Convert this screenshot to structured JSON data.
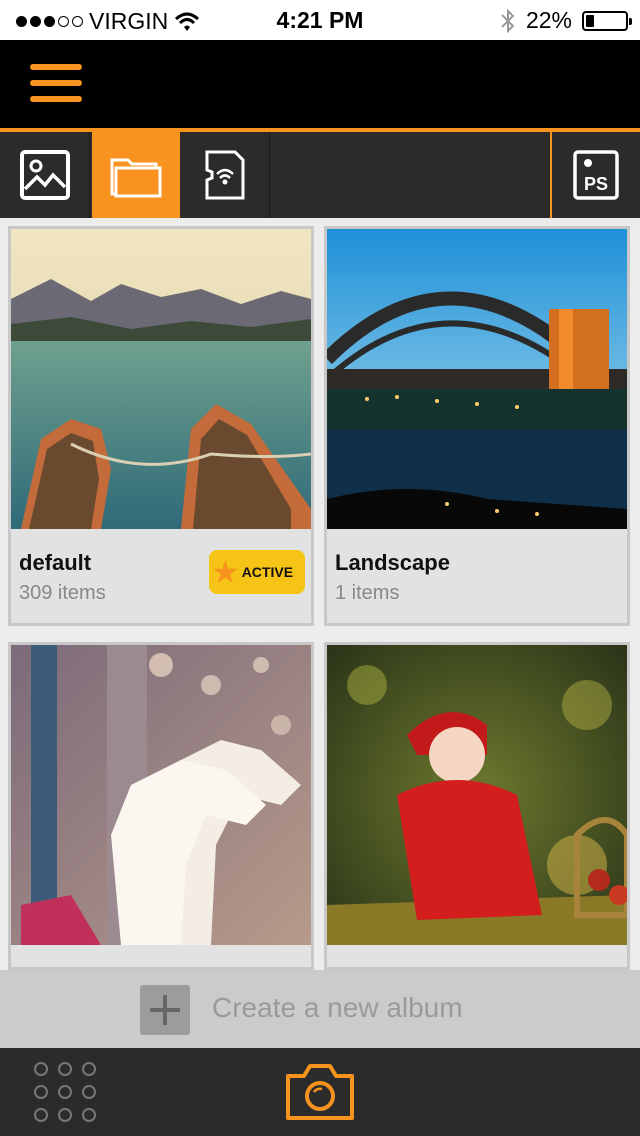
{
  "status_bar": {
    "carrier": "VIRGIN",
    "time": "4:21 PM",
    "battery_text": "22%",
    "battery_level": 0.22
  },
  "header": {
    "menu_icon": "hamburger-menu-icon"
  },
  "tabs": [
    {
      "icon": "image-icon",
      "active": false
    },
    {
      "icon": "folder-icon",
      "active": true
    },
    {
      "icon": "wifi-sd-card-icon",
      "active": false
    },
    {
      "icon": "photoshop-icon",
      "label": "PS",
      "active": false
    }
  ],
  "albums": [
    {
      "name": "default",
      "count": "309 items",
      "badge": "ACTIVE",
      "image": "lake-with-boats"
    },
    {
      "name": "Landscape",
      "count": "1 items",
      "badge": "",
      "image": "harbour-bridge-night"
    },
    {
      "name": "",
      "count": "",
      "badge": "",
      "image": "carousel-horses"
    },
    {
      "name": "",
      "count": "",
      "badge": "",
      "image": "child-in-red-sweater"
    }
  ],
  "create_album": {
    "label": "Create a new album"
  },
  "colors": {
    "accent": "#f7931e",
    "badge": "#f6c317",
    "bar": "#2b2b2b"
  }
}
